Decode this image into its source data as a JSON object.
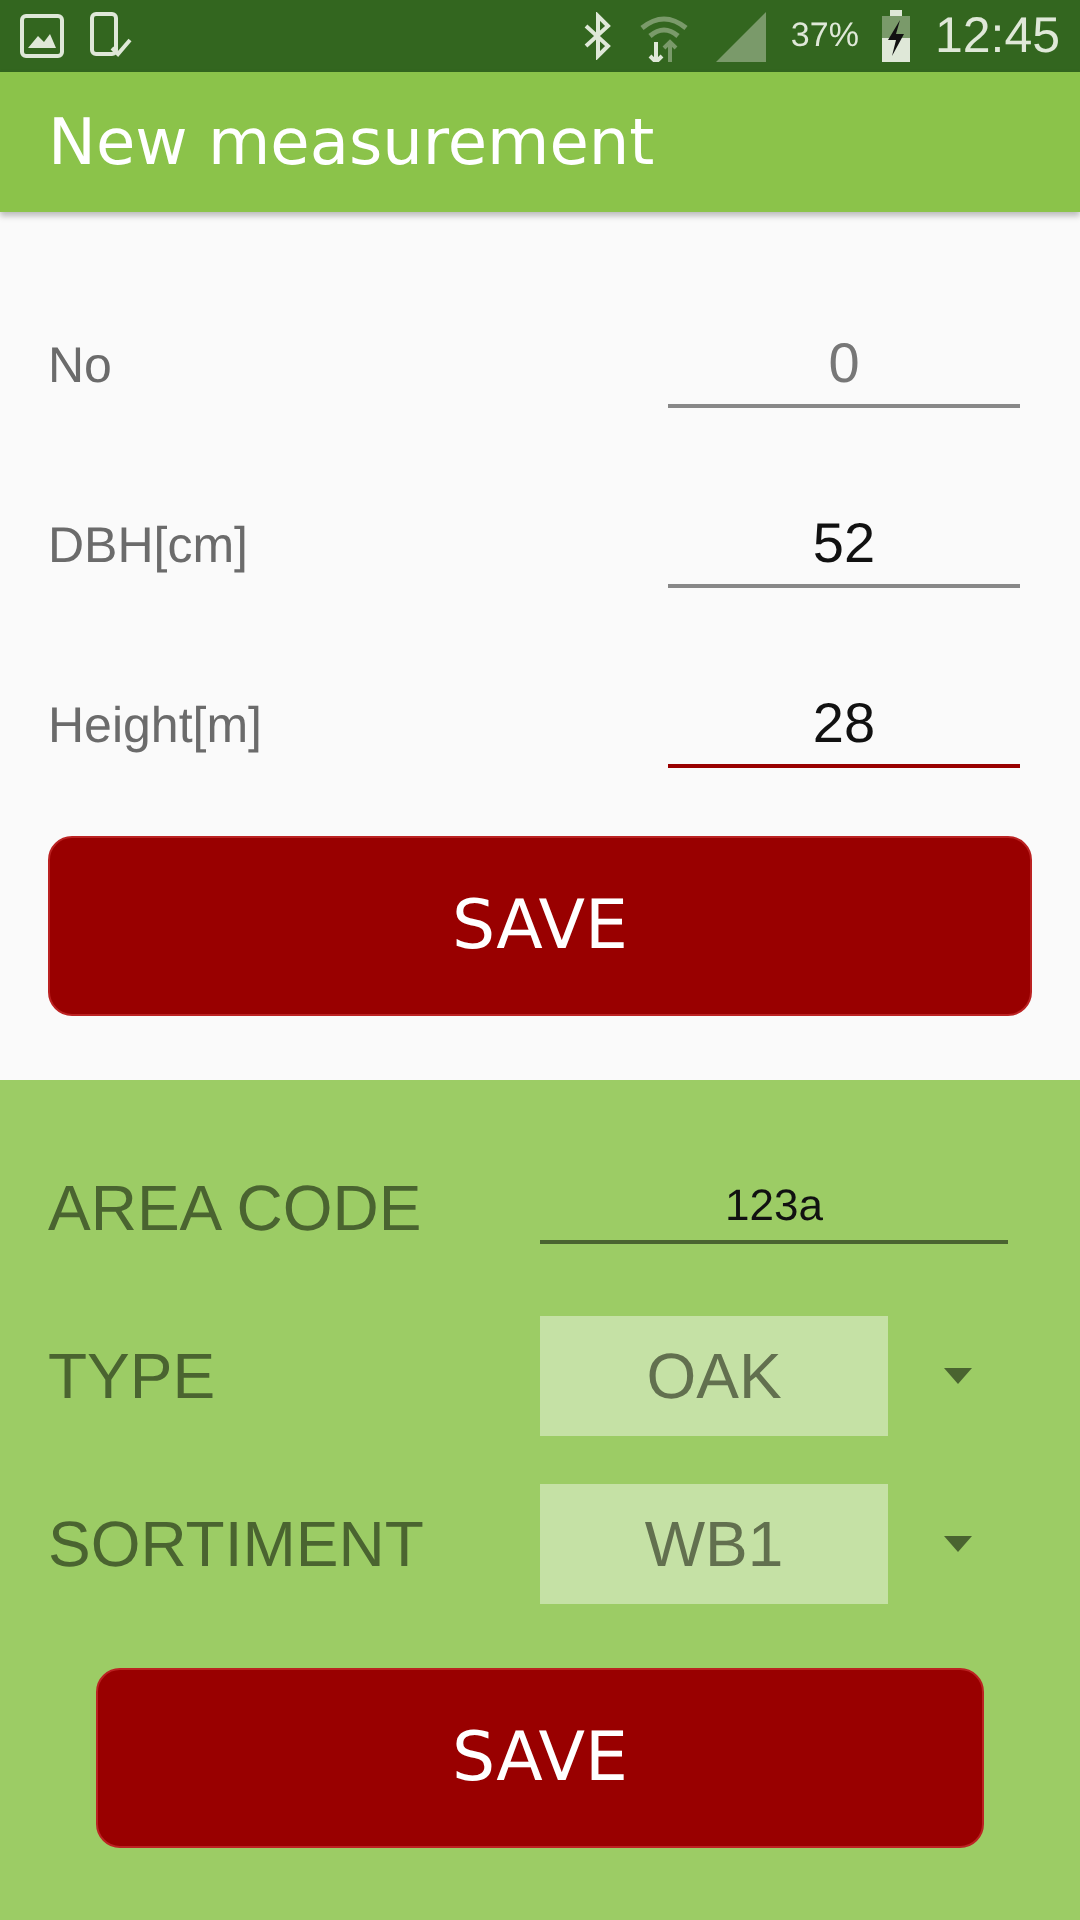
{
  "status_bar": {
    "battery": "37%",
    "time": "12:45"
  },
  "app_bar": {
    "title": "New measurement"
  },
  "measurement_fields": [
    {
      "label": "No",
      "placeholder": "0",
      "focused": false
    },
    {
      "label": "DBH[cm]",
      "value": "52",
      "focused": false
    },
    {
      "label": "Height[m]",
      "value": "28",
      "focused": true
    }
  ],
  "save_button": "SAVE",
  "area_code": {
    "label": "AREA CODE",
    "value": "123a"
  },
  "dropdowns": [
    {
      "label": "TYPE",
      "value": "OAK"
    },
    {
      "label": "SORTIMENT",
      "value": "WB1"
    }
  ],
  "bottom_save_button": "SAVE"
}
